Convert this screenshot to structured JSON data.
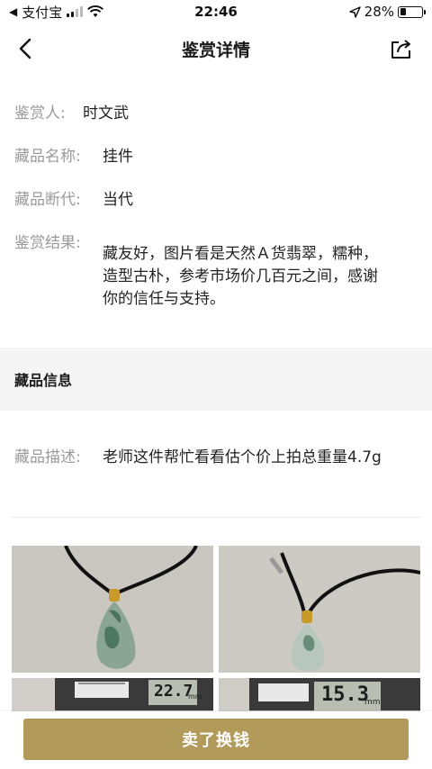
{
  "status_bar": {
    "back_app": "支付宝",
    "time": "22:46",
    "battery_text": "28%",
    "battery_level": 0.28
  },
  "nav": {
    "title": "鉴赏详情",
    "back_icon": "chevron-left-icon",
    "share_icon": "share-icon"
  },
  "appraisal": {
    "appraiser_label": "鉴赏人:",
    "appraiser_value": "时文武",
    "name_label": "藏品名称:",
    "name_value": "挂件",
    "era_label": "藏品断代:",
    "era_value": "当代",
    "result_label": "鉴赏结果:",
    "result_value": "藏友好，图片看是天然Ａ货翡翠，糯种，造型古朴，参考市场价几百元之间，感谢你的信任与支持。"
  },
  "collection_info": {
    "section_title": "藏品信息",
    "description_label": "藏品描述:",
    "description_value": "老师这件帮忙看看估个价上拍总重量4.7g"
  },
  "photos": {
    "caliper_reading_1": "22.7",
    "caliper_reading_2": "15.3",
    "unit": "mm"
  },
  "bottom": {
    "sell_label": "卖了换钱",
    "button_color": "#b29a5a"
  }
}
